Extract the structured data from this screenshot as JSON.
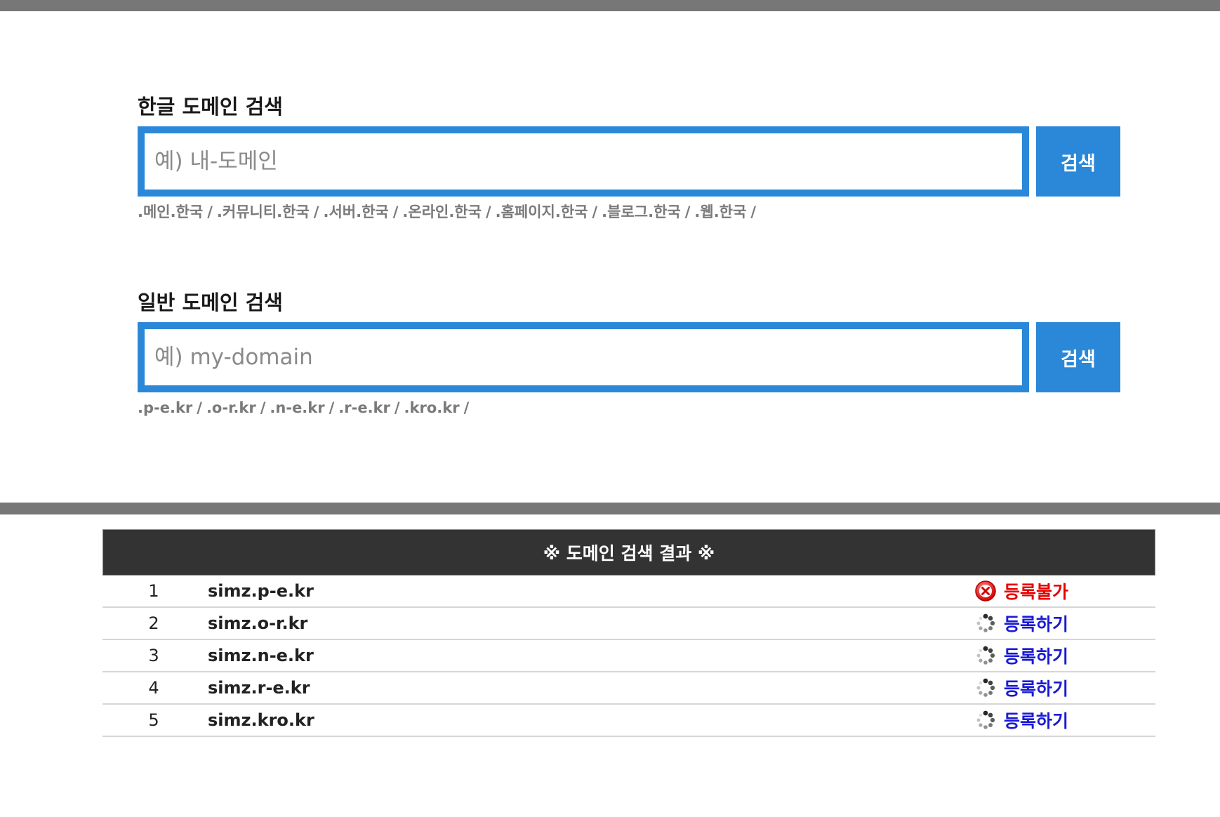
{
  "korean_search": {
    "title": "한글 도메인 검색",
    "placeholder": "예) 내-도메인",
    "button_label": "검색",
    "tlds": [
      ".메인.한국",
      ".커뮤니티.한국",
      ".서버.한국",
      ".온라인.한국",
      ".홈페이지.한국",
      ".블로그.한국",
      ".웹.한국"
    ],
    "separator": "/"
  },
  "general_search": {
    "title": "일반 도메인 검색",
    "placeholder": "예) my-domain",
    "button_label": "검색",
    "tlds": [
      ".p-e.kr",
      ".o-r.kr",
      ".n-e.kr",
      ".r-e.kr",
      ".kro.kr"
    ],
    "separator": "/"
  },
  "results": {
    "header": "※ 도메인 검색 결과 ※",
    "rows": [
      {
        "num": "1",
        "domain": "simz.p-e.kr",
        "status": "등록불가",
        "status_type": "unavailable",
        "icon": "error-icon"
      },
      {
        "num": "2",
        "domain": "simz.o-r.kr",
        "status": "등록하기",
        "status_type": "available",
        "icon": "loading-spinner-icon"
      },
      {
        "num": "3",
        "domain": "simz.n-e.kr",
        "status": "등록하기",
        "status_type": "available",
        "icon": "loading-spinner-icon"
      },
      {
        "num": "4",
        "domain": "simz.r-e.kr",
        "status": "등록하기",
        "status_type": "available",
        "icon": "loading-spinner-icon"
      },
      {
        "num": "5",
        "domain": "simz.kro.kr",
        "status": "등록하기",
        "status_type": "available",
        "icon": "loading-spinner-icon"
      }
    ]
  },
  "colors": {
    "accent": "#2b88d8",
    "header_bg": "#333333",
    "bar": "#777777",
    "unavailable": "#e60000",
    "available": "#1a1ad6"
  }
}
